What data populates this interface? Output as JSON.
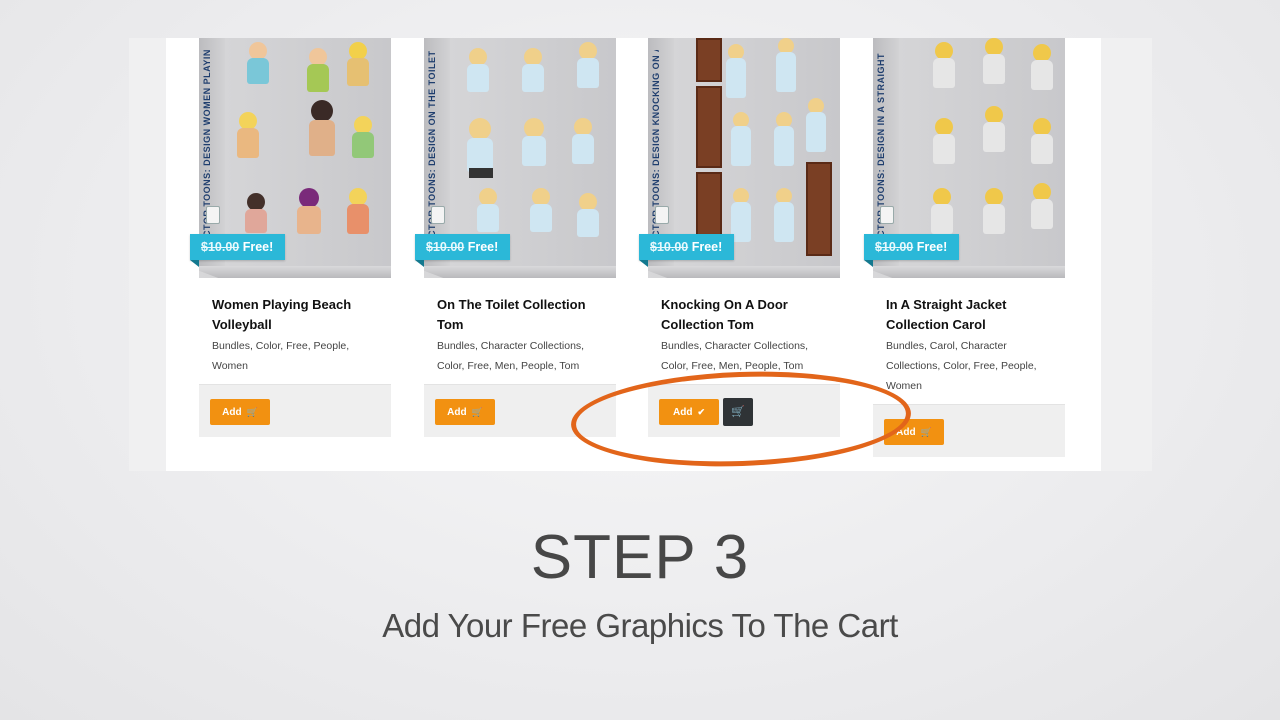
{
  "products": [
    {
      "spine_text": "VECTOR TOONS: DESIGN  WOMEN PLAYING BEACH VOLLEYBALL",
      "old_price": "$10.00",
      "price_label": "Free!",
      "title": "Women Playing Beach Volleyball",
      "tags": "Bundles, Color, Free, People, Women",
      "add_label": "Add",
      "added": false
    },
    {
      "spine_text": "VECTOR TOONS: DESIGN  ON THE TOILET COLLECTION",
      "old_price": "$10.00",
      "price_label": "Free!",
      "title": "On The Toilet Collection Tom",
      "tags": "Bundles, Character Collections, Color, Free, Men, People, Tom",
      "add_label": "Add",
      "added": false
    },
    {
      "spine_text": "VECTOR TOONS: DESIGN  KNOCKING ON A DOOR COLLECTION",
      "old_price": "$10.00",
      "price_label": "Free!",
      "title": "Knocking On A Door Collection Tom",
      "tags": "Bundles, Character Collections, Color, Free, Men, People, Tom",
      "add_label": "Add",
      "added": true,
      "cart_icon": "shopping-cart-icon"
    },
    {
      "spine_text": "VECTOR TOONS: DESIGN  IN A STRAIGHT JACKET COLLECTION",
      "old_price": "$10.00",
      "price_label": "Free!",
      "title": "In A Straight Jacket Collection Carol",
      "tags": "Bundles, Carol, Character Collections, Color, Free, People, Women",
      "add_label": "Add",
      "added": false
    }
  ],
  "icons": {
    "add": "cart-icon",
    "added": "check-icon",
    "view_cart": "shopping-cart-icon"
  },
  "colors": {
    "ribbon": "#2bb8d8",
    "add_button": "#f29111",
    "cart_button": "#2f3336",
    "highlight_circle": "#e2651a"
  },
  "slide": {
    "title": "STEP 3",
    "subtitle": "Add Your Free Graphics To The Cart"
  }
}
